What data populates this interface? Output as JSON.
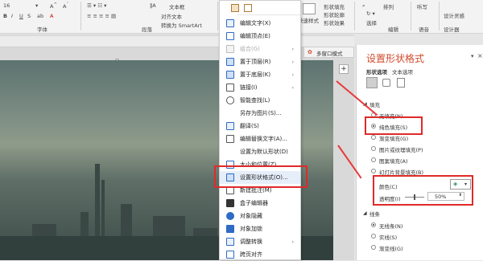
{
  "ribbon": {
    "text_box_label": "文本框",
    "font_group": "字体",
    "paragraph_group": "段落",
    "align_text": "对齐文本",
    "convert_smartart": "转换为 SmartArt",
    "shape_fill": "形状填充",
    "shape_outline": "形状轮廓",
    "shape_effects": "形状效果",
    "quick_styles": "快速样式",
    "arrange": "排列",
    "select": "选择",
    "edit_group": "编辑",
    "voice": "语音",
    "listen": "听写",
    "design_ideas": "设计灵感",
    "designer": "设计器",
    "ideas_label": "设计灵感"
  },
  "mini_toolbar": {
    "multi_window": "多窗口模式"
  },
  "context_menu": {
    "items": [
      {
        "label": "编辑文字(X)",
        "disabled": false,
        "submenu": false
      },
      {
        "label": "编辑顶点(E)",
        "disabled": false,
        "submenu": false
      },
      {
        "label": "组合(G)",
        "disabled": true,
        "submenu": true
      },
      {
        "label": "置于顶层(R)",
        "disabled": false,
        "submenu": true
      },
      {
        "label": "置于底层(K)",
        "disabled": false,
        "submenu": true
      },
      {
        "label": "链接(I)",
        "disabled": false,
        "submenu": true
      },
      {
        "label": "智能查找(L)",
        "disabled": false,
        "submenu": false
      },
      {
        "label": "另存为图片(S)...",
        "disabled": false,
        "submenu": false
      },
      {
        "label": "翻译(S)",
        "disabled": false,
        "submenu": false
      },
      {
        "label": "编辑替换文字(A)...",
        "disabled": false,
        "submenu": false
      },
      {
        "label": "设置为默认形状(D)",
        "disabled": false,
        "submenu": false
      },
      {
        "label": "大小和位置(Z)...",
        "disabled": false,
        "submenu": false
      },
      {
        "label": "设置形状格式(O)...",
        "disabled": false,
        "submenu": false
      },
      {
        "label": "新建批注(M)",
        "disabled": false,
        "submenu": false
      },
      {
        "label": "盒子编辑器",
        "disabled": false,
        "submenu": false
      },
      {
        "label": "对象隐藏",
        "disabled": false,
        "submenu": false
      },
      {
        "label": "对象加锁",
        "disabled": false,
        "submenu": false
      },
      {
        "label": "调整转换",
        "disabled": false,
        "submenu": true
      },
      {
        "label": "跨页对齐",
        "disabled": false,
        "submenu": false
      }
    ]
  },
  "pane": {
    "title": "设置形状格式",
    "tab_shape": "形状选项",
    "tab_text": "文本选项",
    "fill_header": "填充",
    "fill_options": [
      {
        "label": "无填充(N)",
        "selected": false
      },
      {
        "label": "纯色填充(S)",
        "selected": true
      },
      {
        "label": "渐变填充(G)",
        "selected": false
      },
      {
        "label": "图片或纹理填充(P)",
        "selected": false
      },
      {
        "label": "图案填充(A)",
        "selected": false
      },
      {
        "label": "幻灯片背景填充(B)",
        "selected": false
      }
    ],
    "color_label": "颜色(C)",
    "transparency_label": "透明度(I)",
    "transparency_value": "50%",
    "line_header": "线条",
    "line_options": [
      {
        "label": "无线条(N)",
        "selected": true
      },
      {
        "label": "实线(S)",
        "selected": false
      },
      {
        "label": "渐变线(G)",
        "selected": false
      }
    ]
  },
  "colors": {
    "accent": "#d04a2c",
    "highlight_red": "#e02a2a"
  }
}
